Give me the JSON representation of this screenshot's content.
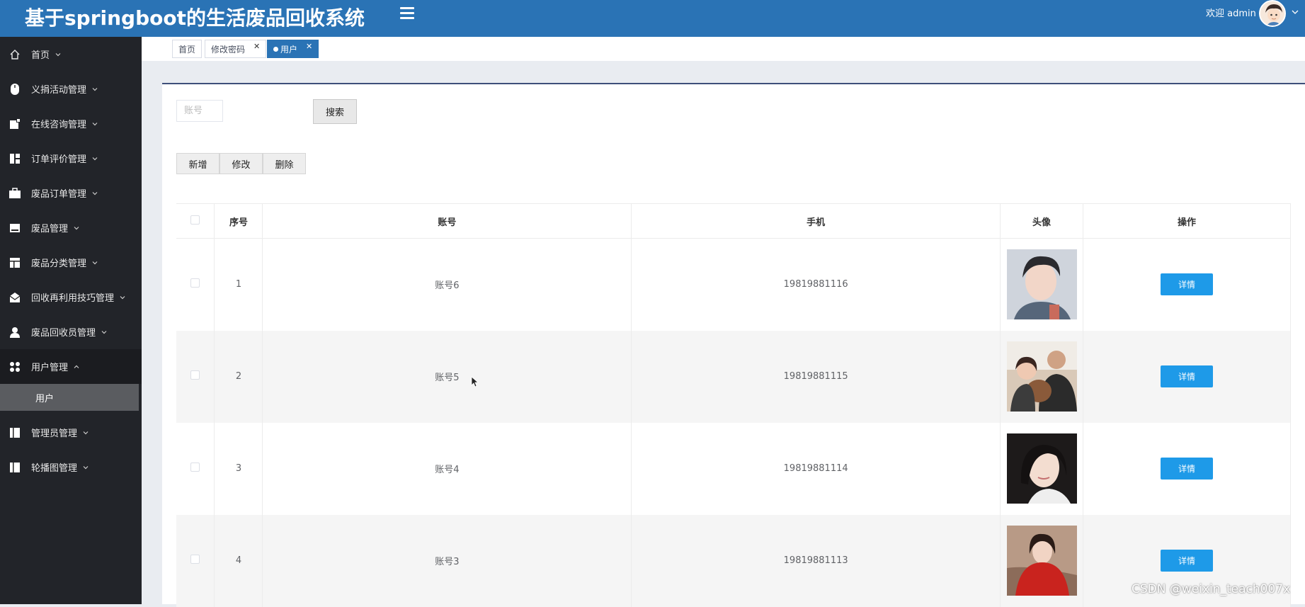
{
  "app": {
    "title": "基于springboot的生活废品回收系统",
    "welcome": "欢迎 admin"
  },
  "sidebar": {
    "items": [
      {
        "label": "首页",
        "icon": "home-icon"
      },
      {
        "label": "义捐活动管理",
        "icon": "mouse-icon"
      },
      {
        "label": "在线咨询管理",
        "icon": "note-icon"
      },
      {
        "label": "订单评价管理",
        "icon": "layout-icon"
      },
      {
        "label": "废品订单管理",
        "icon": "briefcase-icon"
      },
      {
        "label": "废品管理",
        "icon": "box-icon"
      },
      {
        "label": "废品分类管理",
        "icon": "table-icon"
      },
      {
        "label": "回收再利用技巧管理",
        "icon": "mail-icon"
      },
      {
        "label": "废品回收员管理",
        "icon": "person-icon"
      },
      {
        "label": "用户管理",
        "icon": "grid-icon"
      },
      {
        "label": "管理员管理",
        "icon": "book-icon"
      },
      {
        "label": "轮播图管理",
        "icon": "book-icon"
      }
    ],
    "submenu_active": "用户"
  },
  "tabs": [
    {
      "label": "首页"
    },
    {
      "label": "修改密码"
    },
    {
      "label": "用户"
    }
  ],
  "search": {
    "placeholder": "账号",
    "button": "搜索"
  },
  "actions": {
    "add": "新增",
    "edit": "修改",
    "delete": "删除"
  },
  "table": {
    "headers": [
      "序号",
      "账号",
      "手机",
      "头像",
      "操作"
    ],
    "rows": [
      {
        "index": "1",
        "account": "账号6",
        "phone": "19819881116",
        "action": "详情"
      },
      {
        "index": "2",
        "account": "账号5",
        "phone": "19819881115",
        "action": "详情"
      },
      {
        "index": "3",
        "account": "账号4",
        "phone": "19819881114",
        "action": "详情"
      },
      {
        "index": "4",
        "account": "账号3",
        "phone": "19819881113",
        "action": "详情"
      }
    ]
  },
  "watermark": "CSDN @weixin_teach007x",
  "colors": {
    "header": "#2a73b5",
    "sidebar": "#222429",
    "detail_button": "#1e9ae8",
    "active_tab": "#2a73b5"
  }
}
